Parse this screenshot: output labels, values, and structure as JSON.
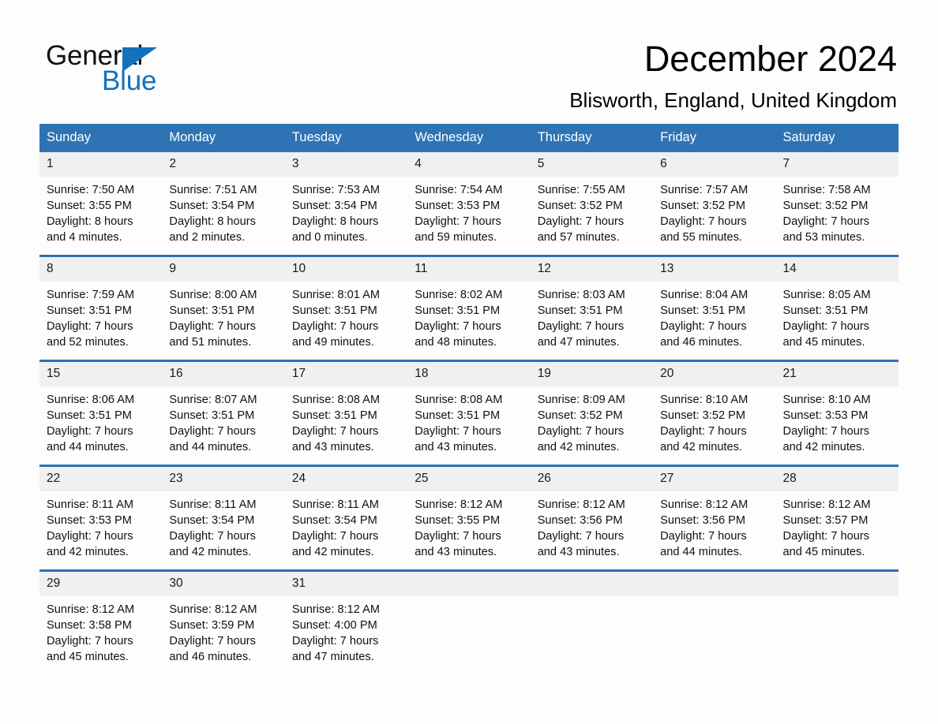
{
  "brand": {
    "word1": "General",
    "word2": "Blue",
    "triangle_color": "#1571bb"
  },
  "header": {
    "title": "December 2024",
    "location": "Blisworth, England, United Kingdom",
    "header_bg": "#2e74b5",
    "row_divider_color": "#2d72b3",
    "day_band_bg": "#f0f0f0"
  },
  "weekdays": [
    "Sunday",
    "Monday",
    "Tuesday",
    "Wednesday",
    "Thursday",
    "Friday",
    "Saturday"
  ],
  "weeks": [
    [
      {
        "day": "1",
        "sunrise": "Sunrise: 7:50 AM",
        "sunset": "Sunset: 3:55 PM",
        "daylight1": "Daylight: 8 hours",
        "daylight2": "and 4 minutes."
      },
      {
        "day": "2",
        "sunrise": "Sunrise: 7:51 AM",
        "sunset": "Sunset: 3:54 PM",
        "daylight1": "Daylight: 8 hours",
        "daylight2": "and 2 minutes."
      },
      {
        "day": "3",
        "sunrise": "Sunrise: 7:53 AM",
        "sunset": "Sunset: 3:54 PM",
        "daylight1": "Daylight: 8 hours",
        "daylight2": "and 0 minutes."
      },
      {
        "day": "4",
        "sunrise": "Sunrise: 7:54 AM",
        "sunset": "Sunset: 3:53 PM",
        "daylight1": "Daylight: 7 hours",
        "daylight2": "and 59 minutes."
      },
      {
        "day": "5",
        "sunrise": "Sunrise: 7:55 AM",
        "sunset": "Sunset: 3:52 PM",
        "daylight1": "Daylight: 7 hours",
        "daylight2": "and 57 minutes."
      },
      {
        "day": "6",
        "sunrise": "Sunrise: 7:57 AM",
        "sunset": "Sunset: 3:52 PM",
        "daylight1": "Daylight: 7 hours",
        "daylight2": "and 55 minutes."
      },
      {
        "day": "7",
        "sunrise": "Sunrise: 7:58 AM",
        "sunset": "Sunset: 3:52 PM",
        "daylight1": "Daylight: 7 hours",
        "daylight2": "and 53 minutes."
      }
    ],
    [
      {
        "day": "8",
        "sunrise": "Sunrise: 7:59 AM",
        "sunset": "Sunset: 3:51 PM",
        "daylight1": "Daylight: 7 hours",
        "daylight2": "and 52 minutes."
      },
      {
        "day": "9",
        "sunrise": "Sunrise: 8:00 AM",
        "sunset": "Sunset: 3:51 PM",
        "daylight1": "Daylight: 7 hours",
        "daylight2": "and 51 minutes."
      },
      {
        "day": "10",
        "sunrise": "Sunrise: 8:01 AM",
        "sunset": "Sunset: 3:51 PM",
        "daylight1": "Daylight: 7 hours",
        "daylight2": "and 49 minutes."
      },
      {
        "day": "11",
        "sunrise": "Sunrise: 8:02 AM",
        "sunset": "Sunset: 3:51 PM",
        "daylight1": "Daylight: 7 hours",
        "daylight2": "and 48 minutes."
      },
      {
        "day": "12",
        "sunrise": "Sunrise: 8:03 AM",
        "sunset": "Sunset: 3:51 PM",
        "daylight1": "Daylight: 7 hours",
        "daylight2": "and 47 minutes."
      },
      {
        "day": "13",
        "sunrise": "Sunrise: 8:04 AM",
        "sunset": "Sunset: 3:51 PM",
        "daylight1": "Daylight: 7 hours",
        "daylight2": "and 46 minutes."
      },
      {
        "day": "14",
        "sunrise": "Sunrise: 8:05 AM",
        "sunset": "Sunset: 3:51 PM",
        "daylight1": "Daylight: 7 hours",
        "daylight2": "and 45 minutes."
      }
    ],
    [
      {
        "day": "15",
        "sunrise": "Sunrise: 8:06 AM",
        "sunset": "Sunset: 3:51 PM",
        "daylight1": "Daylight: 7 hours",
        "daylight2": "and 44 minutes."
      },
      {
        "day": "16",
        "sunrise": "Sunrise: 8:07 AM",
        "sunset": "Sunset: 3:51 PM",
        "daylight1": "Daylight: 7 hours",
        "daylight2": "and 44 minutes."
      },
      {
        "day": "17",
        "sunrise": "Sunrise: 8:08 AM",
        "sunset": "Sunset: 3:51 PM",
        "daylight1": "Daylight: 7 hours",
        "daylight2": "and 43 minutes."
      },
      {
        "day": "18",
        "sunrise": "Sunrise: 8:08 AM",
        "sunset": "Sunset: 3:51 PM",
        "daylight1": "Daylight: 7 hours",
        "daylight2": "and 43 minutes."
      },
      {
        "day": "19",
        "sunrise": "Sunrise: 8:09 AM",
        "sunset": "Sunset: 3:52 PM",
        "daylight1": "Daylight: 7 hours",
        "daylight2": "and 42 minutes."
      },
      {
        "day": "20",
        "sunrise": "Sunrise: 8:10 AM",
        "sunset": "Sunset: 3:52 PM",
        "daylight1": "Daylight: 7 hours",
        "daylight2": "and 42 minutes."
      },
      {
        "day": "21",
        "sunrise": "Sunrise: 8:10 AM",
        "sunset": "Sunset: 3:53 PM",
        "daylight1": "Daylight: 7 hours",
        "daylight2": "and 42 minutes."
      }
    ],
    [
      {
        "day": "22",
        "sunrise": "Sunrise: 8:11 AM",
        "sunset": "Sunset: 3:53 PM",
        "daylight1": "Daylight: 7 hours",
        "daylight2": "and 42 minutes."
      },
      {
        "day": "23",
        "sunrise": "Sunrise: 8:11 AM",
        "sunset": "Sunset: 3:54 PM",
        "daylight1": "Daylight: 7 hours",
        "daylight2": "and 42 minutes."
      },
      {
        "day": "24",
        "sunrise": "Sunrise: 8:11 AM",
        "sunset": "Sunset: 3:54 PM",
        "daylight1": "Daylight: 7 hours",
        "daylight2": "and 42 minutes."
      },
      {
        "day": "25",
        "sunrise": "Sunrise: 8:12 AM",
        "sunset": "Sunset: 3:55 PM",
        "daylight1": "Daylight: 7 hours",
        "daylight2": "and 43 minutes."
      },
      {
        "day": "26",
        "sunrise": "Sunrise: 8:12 AM",
        "sunset": "Sunset: 3:56 PM",
        "daylight1": "Daylight: 7 hours",
        "daylight2": "and 43 minutes."
      },
      {
        "day": "27",
        "sunrise": "Sunrise: 8:12 AM",
        "sunset": "Sunset: 3:56 PM",
        "daylight1": "Daylight: 7 hours",
        "daylight2": "and 44 minutes."
      },
      {
        "day": "28",
        "sunrise": "Sunrise: 8:12 AM",
        "sunset": "Sunset: 3:57 PM",
        "daylight1": "Daylight: 7 hours",
        "daylight2": "and 45 minutes."
      }
    ],
    [
      {
        "day": "29",
        "sunrise": "Sunrise: 8:12 AM",
        "sunset": "Sunset: 3:58 PM",
        "daylight1": "Daylight: 7 hours",
        "daylight2": "and 45 minutes."
      },
      {
        "day": "30",
        "sunrise": "Sunrise: 8:12 AM",
        "sunset": "Sunset: 3:59 PM",
        "daylight1": "Daylight: 7 hours",
        "daylight2": "and 46 minutes."
      },
      {
        "day": "31",
        "sunrise": "Sunrise: 8:12 AM",
        "sunset": "Sunset: 4:00 PM",
        "daylight1": "Daylight: 7 hours",
        "daylight2": "and 47 minutes."
      },
      {
        "day": "",
        "sunrise": "",
        "sunset": "",
        "daylight1": "",
        "daylight2": ""
      },
      {
        "day": "",
        "sunrise": "",
        "sunset": "",
        "daylight1": "",
        "daylight2": ""
      },
      {
        "day": "",
        "sunrise": "",
        "sunset": "",
        "daylight1": "",
        "daylight2": ""
      },
      {
        "day": "",
        "sunrise": "",
        "sunset": "",
        "daylight1": "",
        "daylight2": ""
      }
    ]
  ]
}
